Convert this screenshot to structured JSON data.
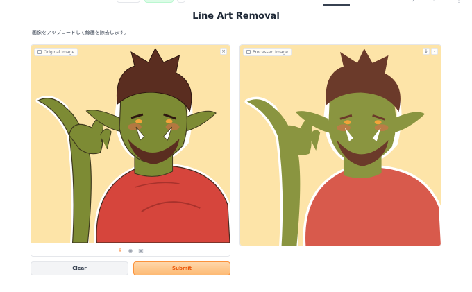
{
  "page": {
    "title": "Line Art Removal",
    "description": "画像をアップロードして線画を除去します。"
  },
  "input_panel": {
    "label": "Original Image",
    "icons": [
      "image-icon",
      "close-icon",
      "upload-icon",
      "microphone-icon",
      "clipboard-icon"
    ]
  },
  "output_panel": {
    "label": "Processed Image",
    "icons": [
      "image-icon",
      "download-icon",
      "share-icon"
    ]
  },
  "buttons": {
    "clear": "Clear",
    "submit": "Submit"
  },
  "colors": {
    "image_background": "#fde4a8",
    "skin": "#7d8b34",
    "shirt": "#d6453c",
    "hair": "#5a2d20",
    "submit_bg": "#fdba74",
    "submit_text": "#ea580c"
  }
}
